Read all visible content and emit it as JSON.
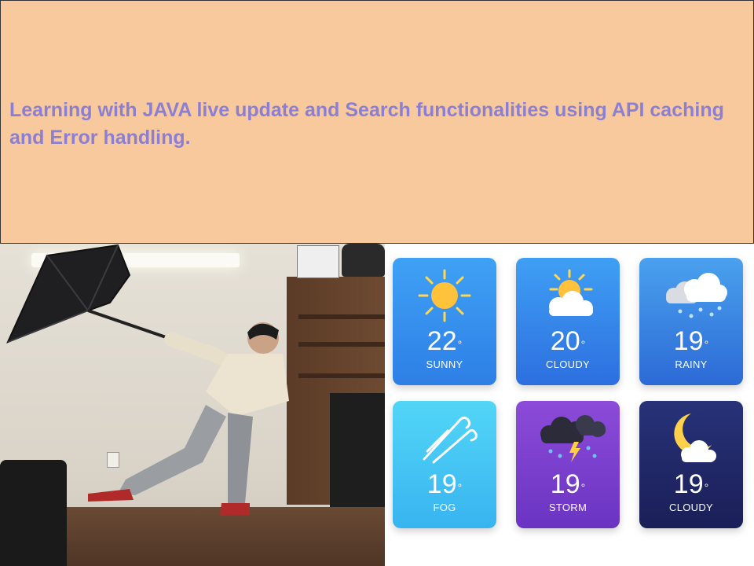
{
  "banner": {
    "text": "Learning with JAVA live update and Search functionalities using API caching and Error handling.",
    "background": "#f7c99c",
    "text_color": "#8b7fd4"
  },
  "weather_cards": [
    {
      "temp": "22",
      "unit": "°",
      "condition": "SUNNY",
      "icon": "sun-icon"
    },
    {
      "temp": "20",
      "unit": "°",
      "condition": "CLOUDY",
      "icon": "partly-cloudy-icon"
    },
    {
      "temp": "19",
      "unit": "°",
      "condition": "RAINY",
      "icon": "rain-cloud-icon"
    },
    {
      "temp": "19",
      "unit": "°",
      "condition": "FOG",
      "icon": "wind-icon"
    },
    {
      "temp": "19",
      "unit": "°",
      "condition": "STORM",
      "icon": "storm-cloud-icon"
    },
    {
      "temp": "19",
      "unit": "°",
      "condition": "CLOUDY",
      "icon": "moon-cloud-icon"
    }
  ]
}
